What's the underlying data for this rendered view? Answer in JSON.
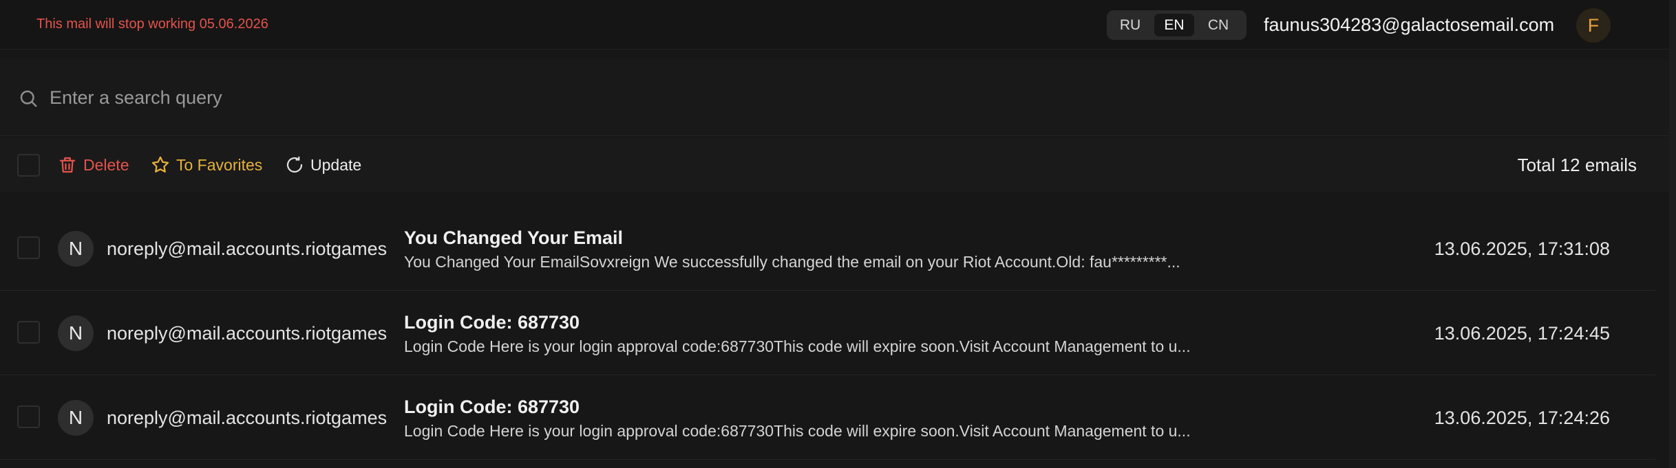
{
  "header": {
    "warning": "This mail will stop working 05.06.2026",
    "languages": [
      "RU",
      "EN",
      "CN"
    ],
    "active_language": "EN",
    "user_email": "faunus304283@galactosemail.com",
    "user_initial": "F"
  },
  "search": {
    "placeholder": "Enter a search query",
    "value": ""
  },
  "toolbar": {
    "delete_label": "Delete",
    "favorites_label": "To Favorites",
    "update_label": "Update",
    "total_label": "Total 12 emails"
  },
  "emails": [
    {
      "initial": "N",
      "sender": "noreply@mail.accounts.riotgames",
      "subject": "You Changed Your Email",
      "preview": "You Changed Your EmailSovxreign We successfully changed the email on your Riot Account.Old: fau*********...",
      "date": "13.06.2025, 17:31:08"
    },
    {
      "initial": "N",
      "sender": "noreply@mail.accounts.riotgames",
      "subject": "Login Code: 687730",
      "preview": "Login Code Here is your login approval code:687730This code will expire soon.Visit Account Management to u...",
      "date": "13.06.2025, 17:24:45"
    },
    {
      "initial": "N",
      "sender": "noreply@mail.accounts.riotgames",
      "subject": "Login Code: 687730",
      "preview": "Login Code Here is your login approval code:687730This code will expire soon.Visit Account Management to u...",
      "date": "13.06.2025, 17:24:26"
    }
  ],
  "colors": {
    "warning": "#e5534b",
    "delete": "#e5534b",
    "favorites": "#e8b23b",
    "avatar_accent": "#e8a13b"
  }
}
